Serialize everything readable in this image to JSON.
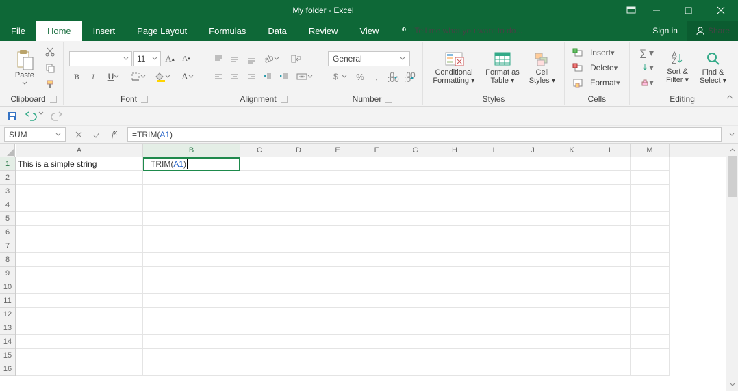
{
  "title": "My folder - Excel",
  "window_buttons": {
    "ribbon_opts": "▾"
  },
  "tabs": [
    "File",
    "Home",
    "Insert",
    "Page Layout",
    "Formulas",
    "Data",
    "Review",
    "View"
  ],
  "active_tab": "Home",
  "tell_me": "Tell me what you want to do...",
  "signin": "Sign in",
  "share": "Share",
  "ribbon": {
    "clipboard": {
      "label": "Clipboard",
      "paste": "Paste"
    },
    "font": {
      "label": "Font",
      "family": "",
      "size": "11",
      "bold": "B",
      "italic": "I",
      "underline": "U"
    },
    "alignment": {
      "label": "Alignment"
    },
    "number": {
      "label": "Number",
      "format": "General"
    },
    "styles": {
      "label": "Styles",
      "cond": "Conditional Formatting",
      "table": "Format as Table",
      "cell": "Cell Styles"
    },
    "cells": {
      "label": "Cells",
      "insert": "Insert",
      "delete": "Delete",
      "format": "Format"
    },
    "editing": {
      "label": "Editing",
      "sort": "Sort & Filter",
      "find": "Find & Select"
    }
  },
  "name_box": "SUM",
  "formula_text_before": "=TRIM(",
  "formula_ref": "A1",
  "formula_text_after": ")",
  "columns": [
    {
      "l": "A",
      "w": 186,
      "hi": false
    },
    {
      "l": "B",
      "w": 142,
      "hi": true
    },
    {
      "l": "C",
      "w": 57
    },
    {
      "l": "D",
      "w": 57
    },
    {
      "l": "E",
      "w": 57
    },
    {
      "l": "F",
      "w": 57
    },
    {
      "l": "G",
      "w": 57
    },
    {
      "l": "H",
      "w": 57
    },
    {
      "l": "I",
      "w": 57
    },
    {
      "l": "J",
      "w": 57
    },
    {
      "l": "K",
      "w": 57
    },
    {
      "l": "L",
      "w": 57
    },
    {
      "l": "M",
      "w": 57
    }
  ],
  "rows": [
    1,
    2,
    3,
    4,
    5,
    6,
    7,
    8,
    9,
    10,
    11,
    12,
    13,
    14,
    15,
    16
  ],
  "hi_row": 1,
  "cell_A1": "This  is    a     simple    string",
  "cell_B1_before": "=TRIM(",
  "cell_B1_ref": "A1",
  "cell_B1_after": ")"
}
